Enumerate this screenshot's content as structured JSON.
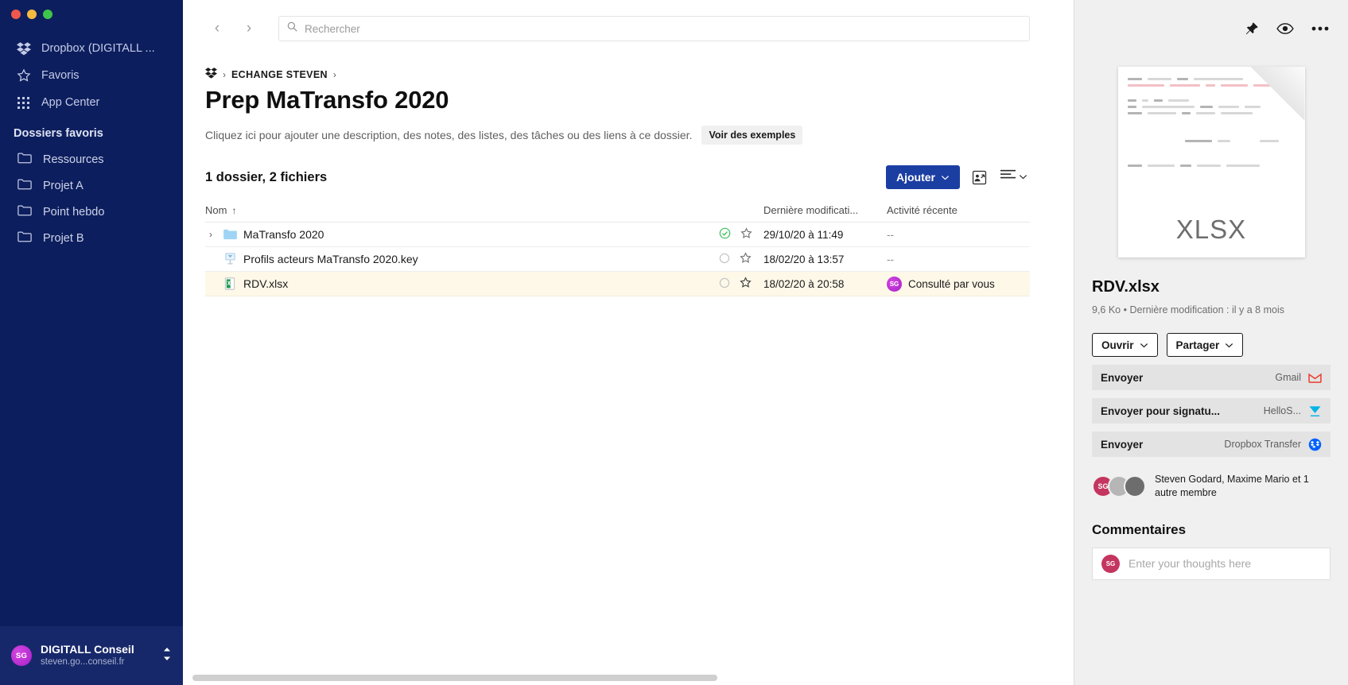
{
  "sidebar": {
    "nav": [
      {
        "label": "Dropbox (DIGITALL ...",
        "icon": "dropbox-icon"
      },
      {
        "label": "Favoris",
        "icon": "star-icon"
      },
      {
        "label": "App Center",
        "icon": "grid-icon"
      }
    ],
    "favorites_title": "Dossiers favoris",
    "favorites": [
      {
        "label": "Ressources",
        "icon": "folder-icon"
      },
      {
        "label": "Projet A",
        "icon": "folder-icon"
      },
      {
        "label": "Point hebdo",
        "icon": "folder-icon"
      },
      {
        "label": "Projet B",
        "icon": "folder-icon"
      }
    ],
    "account": {
      "initials": "SG",
      "name": "DIGITALL Conseil",
      "email": "steven.go...conseil.fr",
      "caret": "⌃⌄"
    }
  },
  "topbar": {
    "back": "‹",
    "forward": "›",
    "search_placeholder": "Rechercher",
    "search_value": ""
  },
  "breadcrumb": {
    "root_icon": "dropbox-icon",
    "sep": "›",
    "items": [
      "ECHANGE STEVEN"
    ]
  },
  "page": {
    "title": "Prep MaTransfo 2020",
    "description": "Cliquez ici pour ajouter une description, des notes, des listes, des tâches ou des liens à ce dossier.",
    "examples_button": "Voir des exemples"
  },
  "toolbar": {
    "count": "1 dossier, 2 fichiers",
    "add_button": "Ajouter",
    "add_caret": "⌄",
    "share_folder_icon": "share-folder-icon",
    "view_list_icon": "list-view-icon",
    "view_caret": "⌄"
  },
  "table": {
    "headers": {
      "name": "Nom",
      "sort_arrow": "↑",
      "modified": "Dernière modificati...",
      "activity": "Activité récente"
    },
    "rows": [
      {
        "name": "MaTransfo 2020",
        "type": "folder",
        "expandable": true,
        "chevron": "›",
        "sync": "synced",
        "star": "☆",
        "modified": "29/10/20 à 11:49",
        "activity": "--",
        "activity_avatar": "",
        "selected": false
      },
      {
        "name": "Profils acteurs MaTransfo 2020.key",
        "type": "keynote",
        "expandable": false,
        "chevron": "",
        "sync": "idle",
        "star": "☆",
        "modified": "18/02/20 à 13:57",
        "activity": "--",
        "activity_avatar": "",
        "selected": false
      },
      {
        "name": "RDV.xlsx",
        "type": "excel",
        "expandable": false,
        "chevron": "",
        "sync": "idle",
        "star": "☆",
        "modified": "18/02/20 à 20:58",
        "activity": "Consulté par vous",
        "activity_avatar": "SG",
        "selected": true
      }
    ]
  },
  "right_panel": {
    "actions": [
      {
        "icon": "pin-icon",
        "name": "pin-button"
      },
      {
        "icon": "eye-icon",
        "name": "preview-button"
      },
      {
        "icon": "ellipsis-icon",
        "name": "more-button"
      }
    ],
    "thumbnail_label": "XLSX",
    "filename": "RDV.xlsx",
    "meta": "9,6 Ko • Dernière modification : il y a 8 mois",
    "buttons": [
      {
        "label": "Ouvrir",
        "caret": "⌄"
      },
      {
        "label": "Partager",
        "caret": "⌄"
      }
    ],
    "send_rows": [
      {
        "label": "Envoyer",
        "service": "Gmail",
        "icon": "gmail-icon"
      },
      {
        "label": "Envoyer pour signatu...",
        "service": "HelloS...",
        "icon": "hellosign-icon"
      },
      {
        "label": "Envoyer",
        "service": "Dropbox Transfer",
        "icon": "dropbox-transfer-icon"
      }
    ],
    "members": {
      "initials": "SG",
      "text": "Steven Godard, Maxime Mario et 1 autre membre"
    },
    "comments_title": "Commentaires",
    "comment_avatar": "SG",
    "comment_placeholder": "Enter your thoughts here",
    "comment_value": ""
  },
  "colors": {
    "sidebar_bg": "#0d1e5e",
    "accent_blue": "#1b3ea3",
    "selected_row": "#fdf8e8",
    "panel_bg": "#f0f0f0"
  }
}
